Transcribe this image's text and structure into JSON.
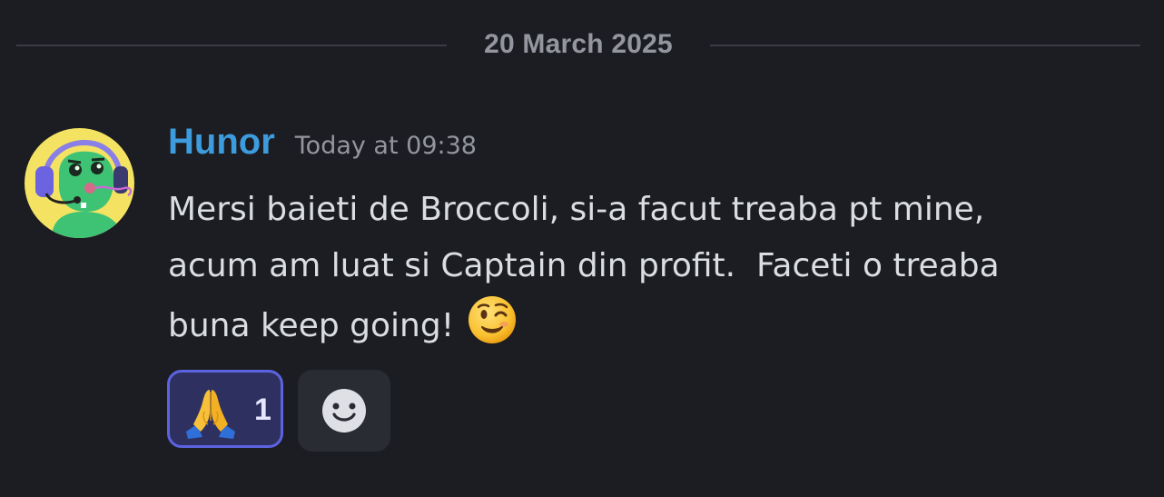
{
  "date_divider": "20 March 2025",
  "message": {
    "author": "Hunor",
    "timestamp": "Today at 09:38",
    "lines": [
      "Mersi baieti de Broccoli, si-a facut treaba pt mine,",
      "acum am luat si Captain din profit.  Faceti o treaba",
      "buna keep going!"
    ],
    "trailing_emoji": "winking-face"
  },
  "reactions": [
    {
      "emoji": "folded-hands",
      "count": "1",
      "reacted_by_me": true
    }
  ],
  "add_reaction_icon": "smiling-face-add-reaction-icon",
  "colors": {
    "background": "#1c1d22",
    "username": "#3d9cde",
    "reaction_active_border": "#5c63e0",
    "reaction_active_bg": "#2e3160"
  }
}
